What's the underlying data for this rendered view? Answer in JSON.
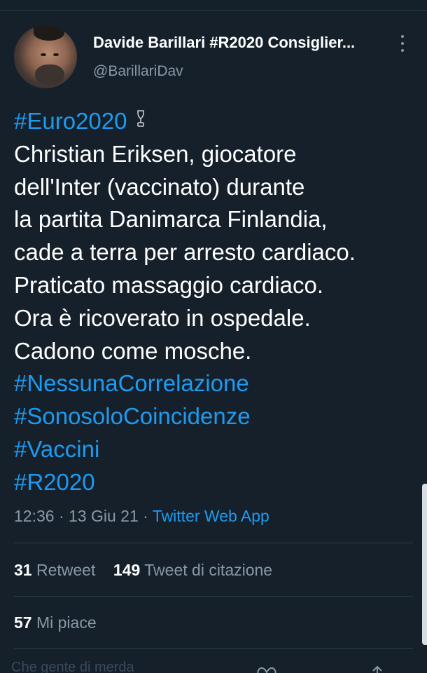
{
  "author": {
    "display_name": "Davide Barillari #R2020 Consiglier...",
    "handle": "@BarillariDav"
  },
  "tweet": {
    "hashtag_top": "#Euro2020",
    "lines": [
      "Christian Eriksen, giocatore",
      "dell'Inter (vaccinato) durante",
      "la partita Danimarca Finlandia,",
      "cade a terra per arresto cardiaco.",
      "Praticato massaggio cardiaco.",
      "Ora è ricoverato in ospedale.",
      "Cadono come mosche."
    ],
    "hashtags": [
      "#NessunaCorrelazione",
      "#SonosoloCoincidenze",
      "#Vaccini",
      "#R2020"
    ]
  },
  "meta": {
    "time": "12:36",
    "separator": " · ",
    "date": "13 Giu 21",
    "source": "Twitter Web App"
  },
  "stats": {
    "retweets_count": "31",
    "retweets_label": "Retweet",
    "quotes_count": "149",
    "quotes_label": "Tweet di citazione",
    "likes_count": "57",
    "likes_label": "Mi piace"
  },
  "reply_preview": {
    "text": "Che gente di merda"
  },
  "icons": {
    "trophy": "trophy-icon",
    "more": "more-options-icon",
    "heart": "heart-icon",
    "share": "share-icon"
  },
  "colors": {
    "background": "#15202b",
    "text": "#ffffff",
    "secondary": "#8899a6",
    "link": "#1d9bf0"
  }
}
